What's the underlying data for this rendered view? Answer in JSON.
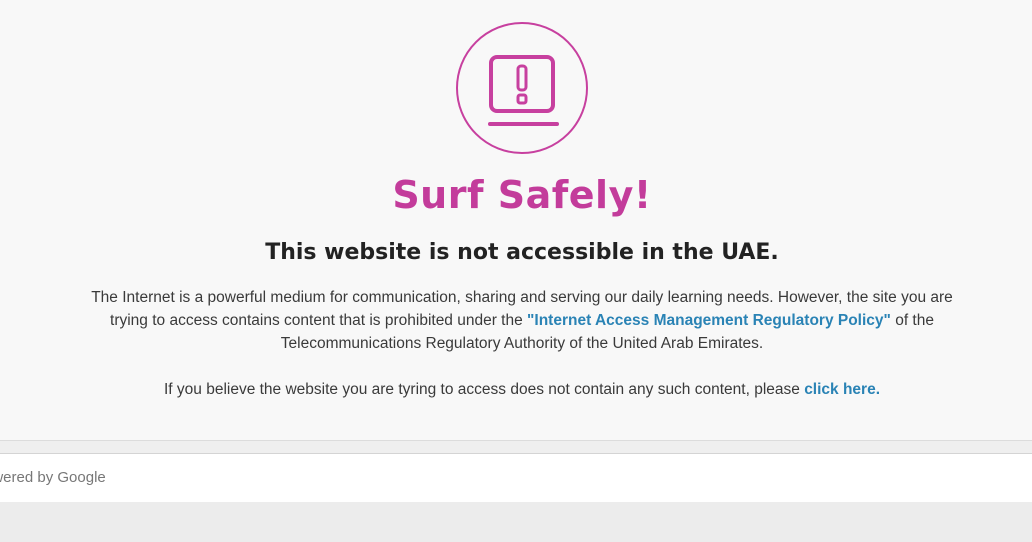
{
  "colors": {
    "accent": "#c7409f",
    "link": "#2a83b5",
    "text": "#3a3a3a"
  },
  "icon": {
    "name": "laptop-warning-icon"
  },
  "heading": {
    "title": "Surf Safely!",
    "subtitle": "This website is not accessible in the UAE."
  },
  "body": {
    "text_before_link": "The Internet is a powerful medium for communication, sharing and serving our daily learning needs. However, the site you are trying to access contains content that is prohibited under the ",
    "policy_link": "\"Internet Access Management Regulatory Policy\"",
    "text_after_link": " of the Telecommunications Regulatory Authority of the United Arab Emirates."
  },
  "notice": {
    "text": "If you believe the website you are tyring to access does not contain any such content, please ",
    "link": "click here."
  },
  "footer": {
    "powered_by": "owered by Google"
  }
}
